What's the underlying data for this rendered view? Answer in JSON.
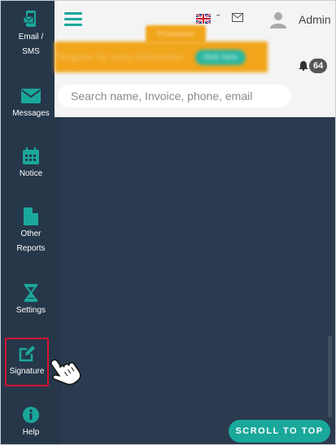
{
  "sidebar": {
    "items": [
      {
        "label": "Email /\nSMS",
        "icon": "email-sms-icon"
      },
      {
        "label": "Messages",
        "icon": "envelope-icon"
      },
      {
        "label": "Notice",
        "icon": "calendar-icon"
      },
      {
        "label": "Other\nReports",
        "icon": "file-icon"
      },
      {
        "label": "Settings",
        "icon": "hourglass-icon"
      },
      {
        "label": "Signature",
        "icon": "edit-icon",
        "active": true
      },
      {
        "label": "Help",
        "icon": "info-circle-icon"
      }
    ]
  },
  "header": {
    "user_name": "Admin",
    "language_icon": "uk-flag-icon",
    "promo": {
      "tab_text": "Promotion",
      "banner_text": "Register for extra information",
      "button_text": "click here"
    },
    "notifications": {
      "count": "64"
    },
    "search": {
      "placeholder": "Search name, Invoice, phone, email",
      "value": ""
    }
  },
  "scroll_top": {
    "label": "SCROLL TO TOP"
  },
  "colors": {
    "sidebar_bg": "#26374a",
    "accent": "#1aa89b",
    "promo": "#f1a51a",
    "active_border": "#d6112e"
  }
}
